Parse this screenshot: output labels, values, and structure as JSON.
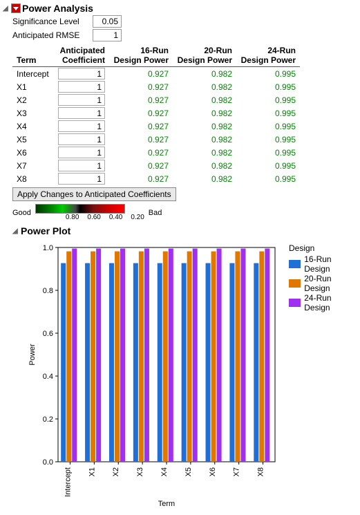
{
  "sections": {
    "power_analysis_title": "Power Analysis",
    "power_plot_title": "Power Plot"
  },
  "params": {
    "sig_label": "Significance Level",
    "sig_value": "0.05",
    "rmse_label": "Anticipated RMSE",
    "rmse_value": "1"
  },
  "table": {
    "headers": {
      "term": "Term",
      "coef_l1": "Anticipated",
      "coef_l2": "Coefficient",
      "r16_l1": "16-Run",
      "r16_l2": "Design Power",
      "r20_l1": "20-Run",
      "r20_l2": "Design Power",
      "r24_l1": "24-Run",
      "r24_l2": "Design Power"
    },
    "rows": [
      {
        "term": "Intercept",
        "coef": "1",
        "p16": "0.927",
        "p20": "0.982",
        "p24": "0.995"
      },
      {
        "term": "X1",
        "coef": "1",
        "p16": "0.927",
        "p20": "0.982",
        "p24": "0.995"
      },
      {
        "term": "X2",
        "coef": "1",
        "p16": "0.927",
        "p20": "0.982",
        "p24": "0.995"
      },
      {
        "term": "X3",
        "coef": "1",
        "p16": "0.927",
        "p20": "0.982",
        "p24": "0.995"
      },
      {
        "term": "X4",
        "coef": "1",
        "p16": "0.927",
        "p20": "0.982",
        "p24": "0.995"
      },
      {
        "term": "X5",
        "coef": "1",
        "p16": "0.927",
        "p20": "0.982",
        "p24": "0.995"
      },
      {
        "term": "X6",
        "coef": "1",
        "p16": "0.927",
        "p20": "0.982",
        "p24": "0.995"
      },
      {
        "term": "X7",
        "coef": "1",
        "p16": "0.927",
        "p20": "0.982",
        "p24": "0.995"
      },
      {
        "term": "X8",
        "coef": "1",
        "p16": "0.927",
        "p20": "0.982",
        "p24": "0.995"
      }
    ]
  },
  "buttons": {
    "apply": "Apply Changes to Anticipated Coefficients"
  },
  "gradient_legend": {
    "good": "Good",
    "bad": "Bad",
    "ticks": [
      "0.80",
      "0.60",
      "0.40",
      "0.20"
    ]
  },
  "plot": {
    "y_axis_label": "Power",
    "x_axis_label": "Term",
    "legend_title": "Design",
    "legend_items": [
      {
        "label": "16-Run Design",
        "color": "#1f6fd6"
      },
      {
        "label": "20-Run Design",
        "color": "#e07800"
      },
      {
        "label": "24-Run Design",
        "color": "#a030f0"
      }
    ]
  },
  "chart_data": {
    "type": "bar",
    "categories": [
      "Intercept",
      "X1",
      "X2",
      "X3",
      "X4",
      "X5",
      "X6",
      "X7",
      "X8"
    ],
    "series": [
      {
        "name": "16-Run Design",
        "color": "#1f6fd6",
        "values": [
          0.927,
          0.927,
          0.927,
          0.927,
          0.927,
          0.927,
          0.927,
          0.927,
          0.927
        ]
      },
      {
        "name": "20-Run Design",
        "color": "#e07800",
        "values": [
          0.982,
          0.982,
          0.982,
          0.982,
          0.982,
          0.982,
          0.982,
          0.982,
          0.982
        ]
      },
      {
        "name": "24-Run Design",
        "color": "#a030f0",
        "values": [
          0.995,
          0.995,
          0.995,
          0.995,
          0.995,
          0.995,
          0.995,
          0.995,
          0.995
        ]
      }
    ],
    "xlabel": "Term",
    "ylabel": "Power",
    "ylim": [
      0.0,
      1.0
    ],
    "yticks": [
      0.0,
      0.2,
      0.4,
      0.6,
      0.8,
      1.0
    ]
  }
}
